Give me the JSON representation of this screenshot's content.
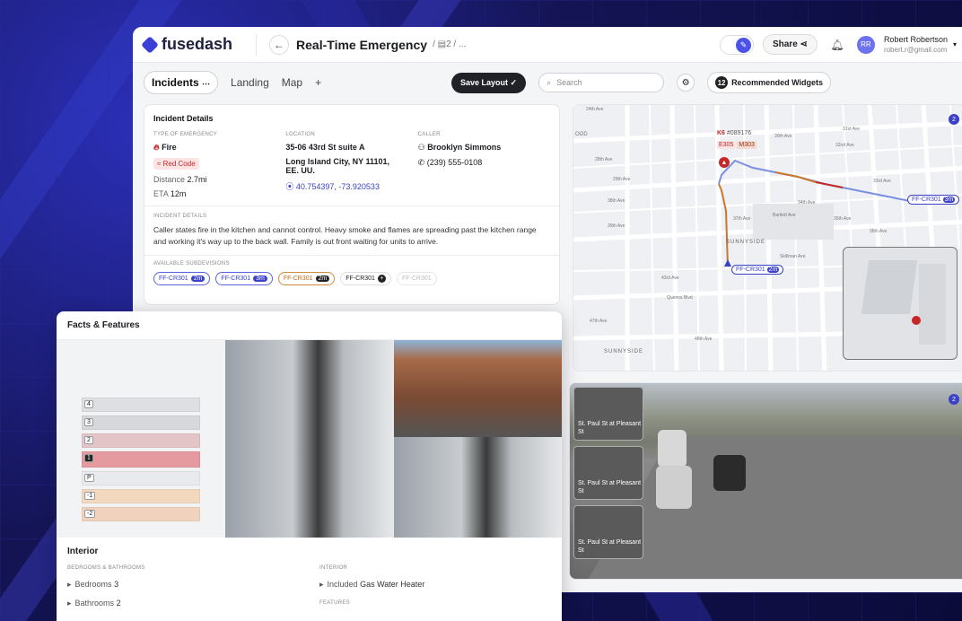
{
  "app": {
    "brand": "fusedash",
    "title": "Real-Time Emergency",
    "crumb_count": "2",
    "crumb_more": "...",
    "share": "Share",
    "user_name": "Robert Robertson",
    "user_email": "robert.r@gmail.com",
    "user_initials": "RR"
  },
  "tabs": [
    {
      "label": "Incidents"
    },
    {
      "label": "Landing"
    },
    {
      "label": "Map"
    }
  ],
  "toolbar": {
    "save": "Save Layout",
    "search_placeholder": "Search",
    "rec_count": "12",
    "rec_label": "Recommended Widgets"
  },
  "incident": {
    "title": "Incident Details",
    "type_label": "TYPE OF EMERGENCY",
    "type": "Fire",
    "code": "Red Code",
    "distance_label": "Distance",
    "distance": "2.7mi",
    "eta_label": "ETA",
    "eta": "12m",
    "location_label": "LOCATION",
    "addr1": "35-06 43rd St suite A",
    "addr2": "Long Island City, NY 11101, EE. UU.",
    "coords": "40.754397, -73.920533",
    "caller_label": "CALLER",
    "caller_name": "Brooklyn Simmons",
    "caller_phone": "(239) 555-0108",
    "details_label": "INCIDENT DETAILS",
    "details": "Caller states fire in the kitchen and cannot control. Heavy smoke and flames are spreading past the kitchen range and working it's way up to the back wall. Family is out front waiting for units to arrive.",
    "subdiv_label": "AVAILABLE SUBDEVISIONS",
    "units": [
      {
        "id": "FF-CR301",
        "t": "2m"
      },
      {
        "id": "FF-CR301",
        "t": "3m"
      },
      {
        "id": "FF-CR301",
        "t": "2m"
      },
      {
        "id": "FF-CR301",
        "t": "+"
      },
      {
        "id": "FF-CR301",
        "t": ""
      }
    ]
  },
  "map": {
    "unit_a": "FF-CR301",
    "unit_a_t": "2m",
    "unit_b": "FF-CR301",
    "unit_b_t": "3m",
    "k6": "K6",
    "k6_id": "#089176",
    "e305": "E305",
    "m303": "M303",
    "badge": "2",
    "sunnyside": "SUNNYSIDE",
    "sunnyside2": "SUNNYSIDE",
    "queens": "Queens Blvd",
    "bartlett": "Bartlett Ave",
    "skillman": "Skillman Ave",
    "ave43": "43rd Ave",
    "ave48": "48th Ave",
    "ave47": "47th Ave",
    "ave37": "37th Ave",
    "ave38": "38th Ave",
    "ave39": "39th Ave",
    "st31": "31st Ave",
    "ave32": "32nd Ave",
    "ave34": "34th Ave",
    "ave35": "35th Ave",
    "ave36": "36th Ave",
    "ave24": "24th Ave",
    "ave28": "28th Ave",
    "ave29": "29th Ave",
    "ave30": "30th Ave",
    "ave33": "33rd Ave",
    "rd": "ood"
  },
  "cams": [
    {
      "label": "St. Paul St at Pleasant St"
    },
    {
      "label": "St. Paul St at Pleasant St"
    },
    {
      "label": "St. Paul St at Pleasant St"
    }
  ],
  "cam_badge": "2",
  "facts": {
    "title": "Facts & Features",
    "floors": [
      "4",
      "3",
      "2",
      "1",
      "P",
      "-1",
      "-2"
    ],
    "interior_title": "Interior",
    "bed_label": "BEDROOMS & BATHROOMS",
    "bedrooms_label": "Bedrooms",
    "bedrooms": "3",
    "bathrooms_label": "Bathrooms",
    "bathrooms": "2",
    "int_label": "INTERIOR",
    "included_label": "Included",
    "included": "Gas Water Heater",
    "features_label": "FEATURES"
  },
  "colors": {
    "accent": "#3b42c8",
    "danger": "#c62828",
    "dark": "#202227"
  }
}
